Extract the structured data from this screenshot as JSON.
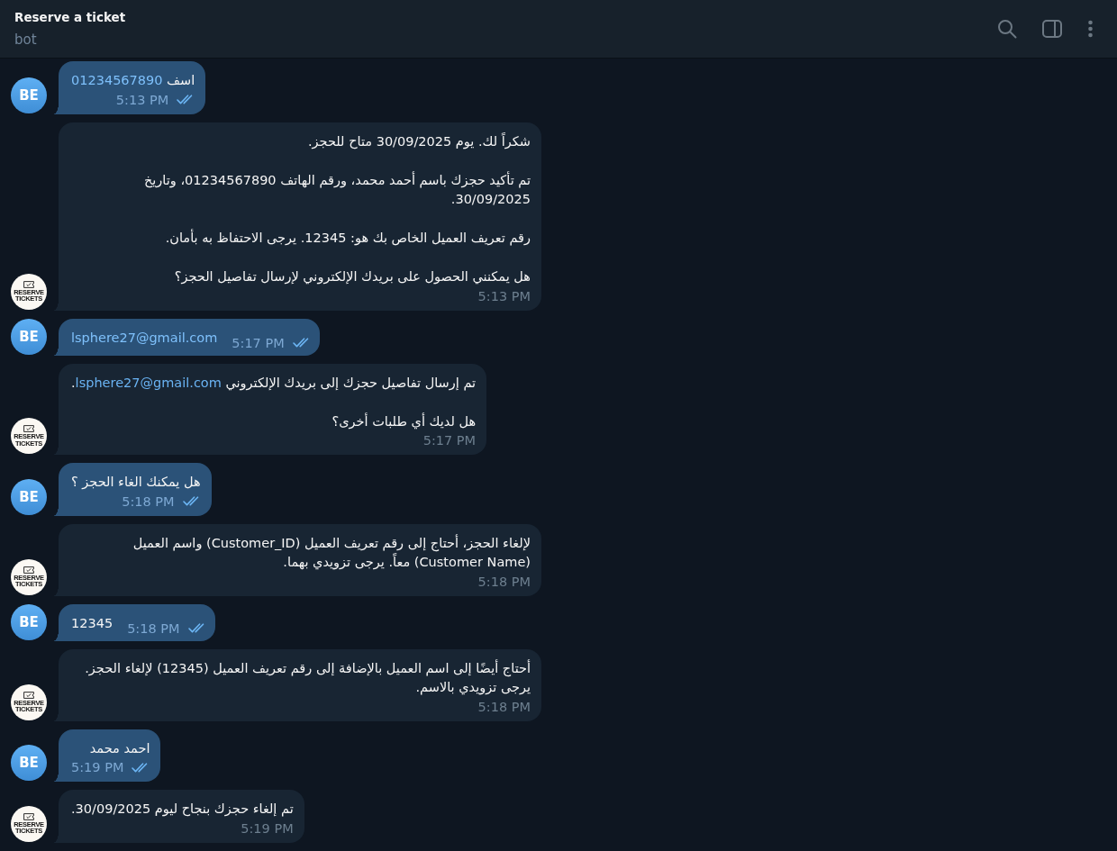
{
  "header": {
    "title": "Reserve a ticket",
    "subtitle": "bot"
  },
  "messages": [
    {
      "kind": "sent",
      "avatar": {
        "kind": "initials",
        "text": "BE"
      },
      "paragraphs": [
        [
          {
            "kind": "text",
            "text": "اسف "
          },
          {
            "kind": "link",
            "text": "01234567890"
          }
        ]
      ],
      "time": "5:13 PM",
      "read": true
    },
    {
      "kind": "received",
      "avatar": {
        "kind": "logo",
        "lines": [
          "RESERVE",
          "TICKETS"
        ]
      },
      "paragraphs": [
        [
          {
            "kind": "text",
            "text": "شكراً لك. يوم 30/09/2025 متاح للحجز."
          }
        ],
        [
          {
            "kind": "text",
            "text": "تم تأكيد حجزك باسم أحمد محمد، ورقم الهاتف 01234567890، وتاريخ 30/09/2025."
          }
        ],
        [
          {
            "kind": "text",
            "text": "رقم تعريف العميل الخاص بك هو: 12345. يرجى الاحتفاظ به بأمان."
          }
        ],
        [
          {
            "kind": "text",
            "text": "هل يمكنني الحصول على بريدك الإلكتروني لإرسال تفاصيل الحجز؟"
          }
        ]
      ],
      "time": "5:13 PM"
    },
    {
      "kind": "sent",
      "avatar": {
        "kind": "initials",
        "text": "BE"
      },
      "paragraphs": [
        [
          {
            "kind": "link",
            "text": "lsphere27@gmail.com"
          }
        ]
      ],
      "time": "5:17 PM",
      "read": true
    },
    {
      "kind": "received",
      "avatar": {
        "kind": "logo",
        "lines": [
          "RESERVE",
          "TICKETS"
        ]
      },
      "paragraphs": [
        [
          {
            "kind": "text",
            "text": "تم إرسال تفاصيل حجزك إلى بريدك الإلكتروني "
          },
          {
            "kind": "link",
            "text": "lsphere27@gmail.com"
          },
          {
            "kind": "text",
            "text": "."
          }
        ],
        [
          {
            "kind": "text",
            "text": "هل لديك أي طلبات أخرى؟"
          }
        ]
      ],
      "time": "5:17 PM"
    },
    {
      "kind": "sent",
      "avatar": {
        "kind": "initials",
        "text": "BE"
      },
      "paragraphs": [
        [
          {
            "kind": "text",
            "text": "هل يمكنك الغاء الحجز ؟"
          }
        ]
      ],
      "time": "5:18 PM",
      "read": true
    },
    {
      "kind": "received",
      "avatar": {
        "kind": "logo",
        "lines": [
          "RESERVE",
          "TICKETS"
        ]
      },
      "paragraphs": [
        [
          {
            "kind": "text",
            "text": "لإلغاء الحجز، أحتاج إلى رقم تعريف العميل (Customer_ID) واسم العميل (Customer Name) معاً. يرجى تزويدي بهما."
          }
        ]
      ],
      "time": "5:18 PM"
    },
    {
      "kind": "sent",
      "avatar": {
        "kind": "initials",
        "text": "BE"
      },
      "paragraphs": [
        [
          {
            "kind": "text",
            "text": "12345"
          }
        ]
      ],
      "time": "5:18 PM",
      "read": true
    },
    {
      "kind": "received",
      "avatar": {
        "kind": "logo",
        "lines": [
          "RESERVE",
          "TICKETS"
        ]
      },
      "paragraphs": [
        [
          {
            "kind": "text",
            "text": "أحتاج أيضًا إلى اسم العميل بالإضافة إلى رقم تعريف العميل (12345) لإلغاء الحجز. يرجى تزويدي بالاسم."
          }
        ]
      ],
      "time": "5:18 PM"
    },
    {
      "kind": "sent",
      "avatar": {
        "kind": "initials",
        "text": "BE"
      },
      "paragraphs": [
        [
          {
            "kind": "text",
            "text": "احمد محمد"
          }
        ]
      ],
      "time": "5:19 PM",
      "read": true
    },
    {
      "kind": "received",
      "avatar": {
        "kind": "logo",
        "lines": [
          "RESERVE",
          "TICKETS"
        ]
      },
      "paragraphs": [
        [
          {
            "kind": "text",
            "text": "تم إلغاء حجزك بنجاح ليوم 30/09/2025."
          }
        ]
      ],
      "time": "5:19 PM"
    }
  ]
}
